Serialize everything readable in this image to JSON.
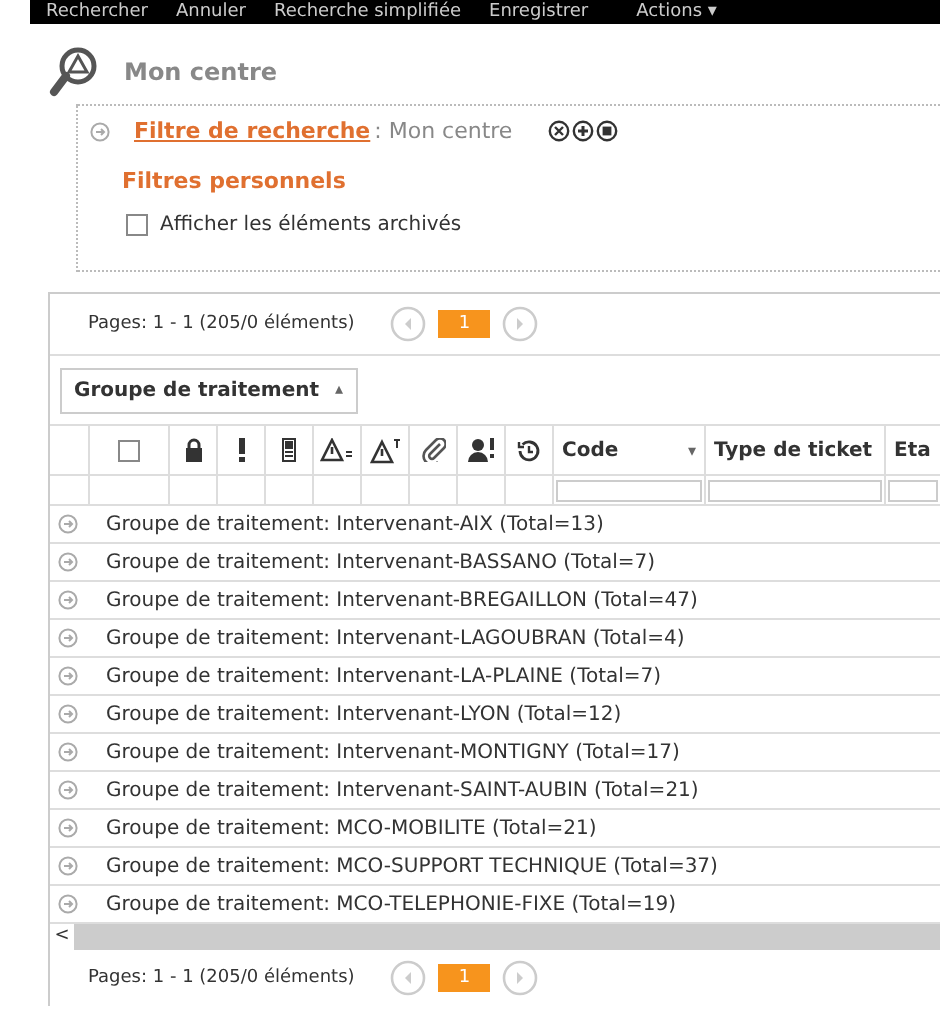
{
  "menu": [
    "Rechercher",
    "Annuler",
    "Recherche simplifiée",
    "Enregistrer",
    "Actions ▾"
  ],
  "title": "Mon centre",
  "filter": {
    "link": "Filtre de recherche",
    "separator": ":",
    "value": "Mon centre",
    "personal": "Filtres personnels",
    "archived": {
      "label": "Afficher les éléments archivés",
      "checked": false
    }
  },
  "pager_top": {
    "text": "Pages: 1 - 1 (205/0 éléments)",
    "page": "1"
  },
  "group_chip": "Groupe de traitement",
  "group_chip_sort": "▴",
  "select_all": {
    "checked": false
  },
  "columns": [
    {
      "label": "Code",
      "sort": "▾"
    },
    {
      "label": "Type de ticket"
    },
    {
      "label": "Eta"
    }
  ],
  "rows": [
    "Groupe de traitement: Intervenant-AIX (Total=13)",
    "Groupe de traitement: Intervenant-BASSANO (Total=7)",
    "Groupe de traitement: Intervenant-BREGAILLON (Total=47)",
    "Groupe de traitement: Intervenant-LAGOUBRAN (Total=4)",
    "Groupe de traitement: Intervenant-LA-PLAINE (Total=7)",
    "Groupe de traitement: Intervenant-LYON (Total=12)",
    "Groupe de traitement: Intervenant-MONTIGNY (Total=17)",
    "Groupe de traitement: Intervenant-SAINT-AUBIN (Total=21)",
    "Groupe de traitement: MCO-MOBILITE (Total=21)",
    "Groupe de traitement: MCO-SUPPORT TECHNIQUE (Total=37)",
    "Groupe de traitement: MCO-TELEPHONIE-FIXE (Total=19)"
  ],
  "scroll_left": "<",
  "pager_bottom": {
    "text": "Pages: 1 - 1 (205/0 éléments)",
    "page": "1"
  }
}
